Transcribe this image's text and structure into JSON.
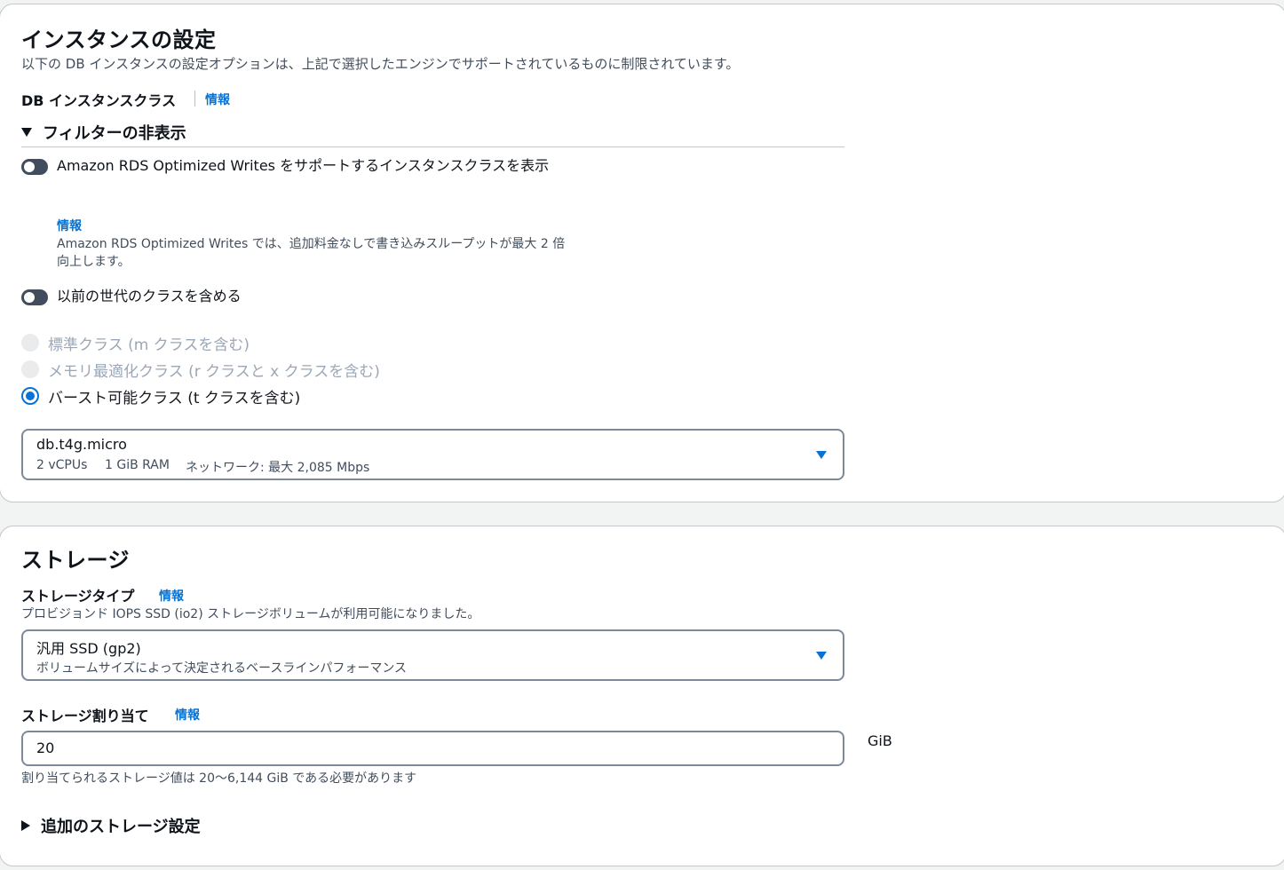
{
  "instance": {
    "title": "インスタンスの設定",
    "description": "以下の DB インスタンスの設定オプションは、上記で選択したエンジンでサポートされているものに制限されています。",
    "class_label": "DB インスタンスクラス",
    "info": "情報",
    "filter_toggle": "フィルターの非表示",
    "optimized_writes_label": "Amazon RDS Optimized Writes をサポートするインスタンスクラスを表示",
    "optimized_writes_info": "情報",
    "optimized_writes_desc": "Amazon RDS Optimized Writes では、追加料金なしで書き込みスループットが最大 2 倍向上します。",
    "prev_gen_label": "以前の世代のクラスを含める",
    "radios": [
      {
        "label": "標準クラス (m クラスを含む)",
        "state": "disabled"
      },
      {
        "label": "メモリ最適化クラス (r クラスと x クラスを含む)",
        "state": "disabled"
      },
      {
        "label": "バースト可能クラス (t クラスを含む)",
        "state": "checked"
      }
    ],
    "selected_class": {
      "name": "db.t4g.micro",
      "vcpus": "2 vCPUs",
      "ram": "1 GiB RAM",
      "network": "ネットワーク: 最大 2,085 Mbps"
    }
  },
  "storage": {
    "title": "ストレージ",
    "type_label": "ストレージタイプ",
    "info": "情報",
    "type_notice": "プロビジョンド IOPS SSD (io2) ストレージボリュームが利用可能になりました。",
    "selected_type": {
      "name": "汎用 SSD (gp2)",
      "description": "ボリュームサイズによって決定されるベースラインパフォーマンス"
    },
    "allocation_label": "ストレージ割り当て",
    "allocation_info": "情報",
    "allocation_value": "20",
    "allocation_unit": "GiB",
    "allocation_hint": "割り当てられるストレージ値は 20～6,144 GiB である必要があります",
    "additional_settings": "追加のストレージ設定"
  },
  "colors": {
    "link": "#0972d3",
    "toggle_off": "#414d5c",
    "radio_selected": "#0972d3",
    "border": "#7d8998"
  },
  "icons": [
    "caret-down-icon",
    "expand-triangle-icon",
    "collapse-triangle-icon"
  ]
}
